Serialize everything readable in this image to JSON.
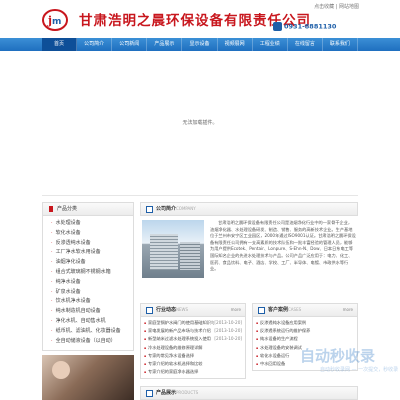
{
  "header": {
    "company": "甘肃浩明之晨环保设备有限责任公司",
    "top_links": "点击收藏 | 网站地图",
    "phone": "0931-8881130"
  },
  "nav": [
    "首页",
    "公司简介",
    "公司新闻",
    "产品展示",
    "显示设备",
    "视频展网",
    "工程业绩",
    "在线留言",
    "联系我们"
  ],
  "banner": {
    "text": "无法加载插件。"
  },
  "categories": {
    "title": "产品分类",
    "items": [
      "水处理设备",
      "软化水设备",
      "反渗透纯水设备",
      "工厂净水软水用设备",
      "油烟净化设备",
      "组合式玻璃钢不锈钢水箱",
      "纯净水设备",
      "矿泉水设备",
      "饮水机净水设备",
      "纯水制造机自动设备",
      "净化水机、自动售水机",
      "纸币机、滤油机、化妆器设备",
      "全自动储液设备（以自动）"
    ]
  },
  "about": {
    "title": "公司简介",
    "sub": "COMPANY",
    "more": "more",
    "text": "甘肃浩明之晨环保设备有限责任公司是油烟净化行业中的一家骨干企业，油烟净化器、水处理设备研发、制造、销售、服务的高新技术企业。生产基地位于兰州市安宁区工业园区，2000年通过ISO9001认证。甘肃浩明之晨环保设备有限责任公司拥有一支高素质的技术队伍和一批丰富经验的管理人员，能够为用户提供Ecotek、Pentair、Lonpure、S-Ehn-N、Dow、日本日东电工等国际知名企业的先进水处理技术与产品。公司产品广泛应用于：电力、化工、医药、食品饮料、电子、酒店、学校、工厂、半导体、电镀、市政供水等行业。"
  },
  "news": {
    "title": "行业动态",
    "sub": "NEWS",
    "more": "more",
    "items": [
      {
        "t": "家庭型锅炉水阀门的使用基础知识与维护",
        "d": "[2013-10-20]"
      },
      {
        "t": "家电发展的新产品市场与技术介绍",
        "d": "[2013-10-20]"
      },
      {
        "t": "新型纳米过滤水处理系统投入使用",
        "d": "[2013-10-20]"
      },
      {
        "t": "冷水处理设备的维修原理详解",
        "d": ""
      },
      {
        "t": "专家的常见净水设备选择",
        "d": ""
      },
      {
        "t": "专家介绍的软水机选择和比较",
        "d": ""
      },
      {
        "t": "专家介绍的家庭净水器选择",
        "d": ""
      }
    ]
  },
  "cases": {
    "title": "客户案例",
    "sub": "CASES",
    "more": "more",
    "items": [
      "反渗透纯水设备应用案例",
      "反渗透系统运行的维护保养",
      "纯水设备的生产流程",
      "水处理设备的安装调试",
      "软化水设备运行",
      "中水回用设备"
    ]
  },
  "products": {
    "title": "产品展示",
    "sub": "PRODUCTS"
  },
  "watermark": {
    "main": "自动秒收录",
    "sub": "自动秒收录网 — 一次提交，秒收录"
  }
}
